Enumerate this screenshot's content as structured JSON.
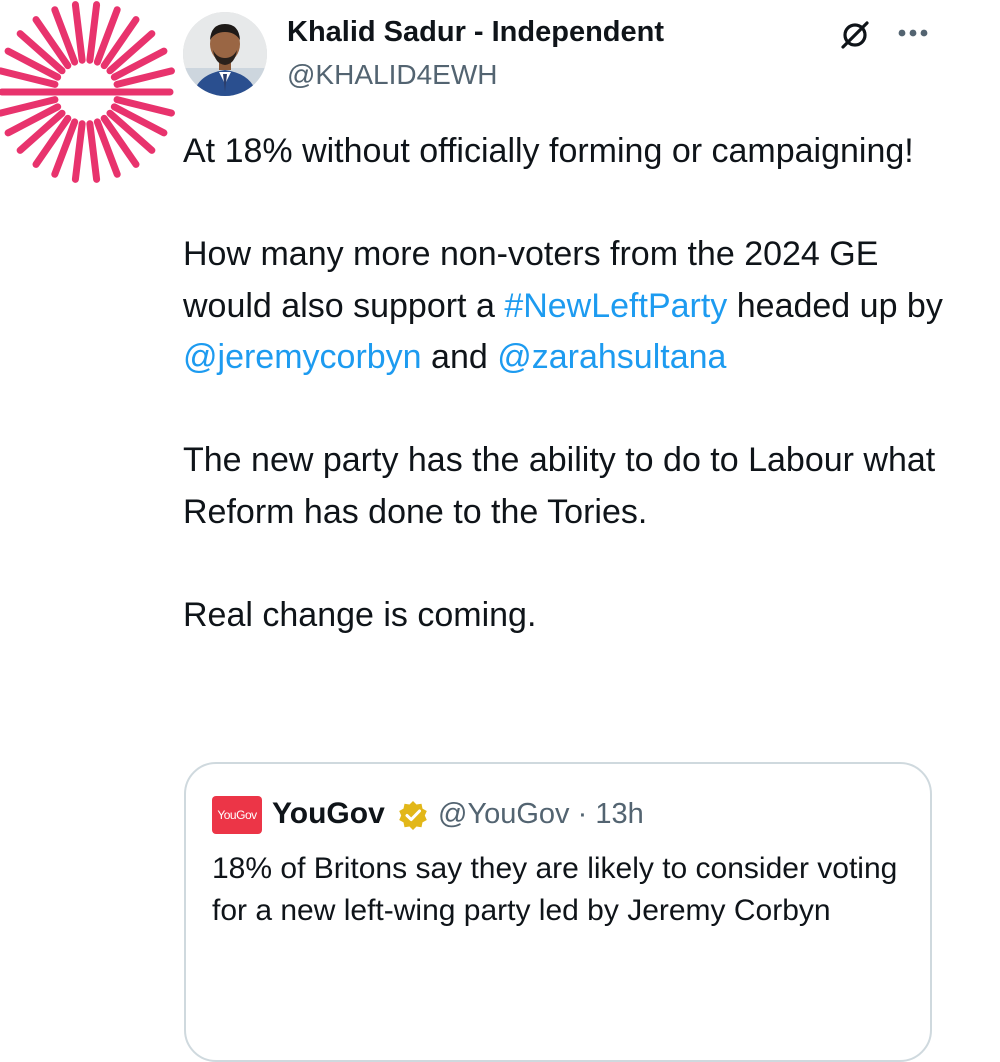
{
  "brand": {
    "sunburst_color": "#e8336d"
  },
  "tweet": {
    "author_name": "Khalid Sadur - Independent",
    "author_handle": "@KHALID4EWH",
    "body": {
      "p1": "At 18% without officially forming or campaigning!",
      "p2_text1": "How many more non-voters from the 2024 GE would also support a ",
      "p2_hashtag": "#NewLeftParty",
      "p2_text2": " headed up by ",
      "p2_mention1": "@jeremycorbyn",
      "p2_text3": " and ",
      "p2_mention2": "@zarahsultana",
      "p3": "The new party has the ability to do to Labour what Reform has done to the Tories.",
      "p4": "Real change is coming."
    },
    "icons": {
      "grok": "grok-icon",
      "more": "more-icon"
    },
    "link_color": "#1d9bf0"
  },
  "quote": {
    "logo_text": "YouGov",
    "name": "YouGov",
    "handle_time": "@YouGov · 13h",
    "text": "18% of Britons say they are likely to consider voting for a new left-wing party led by Jeremy Corbyn",
    "logo_color": "#ec3547",
    "verified_color": "#e2b719"
  }
}
